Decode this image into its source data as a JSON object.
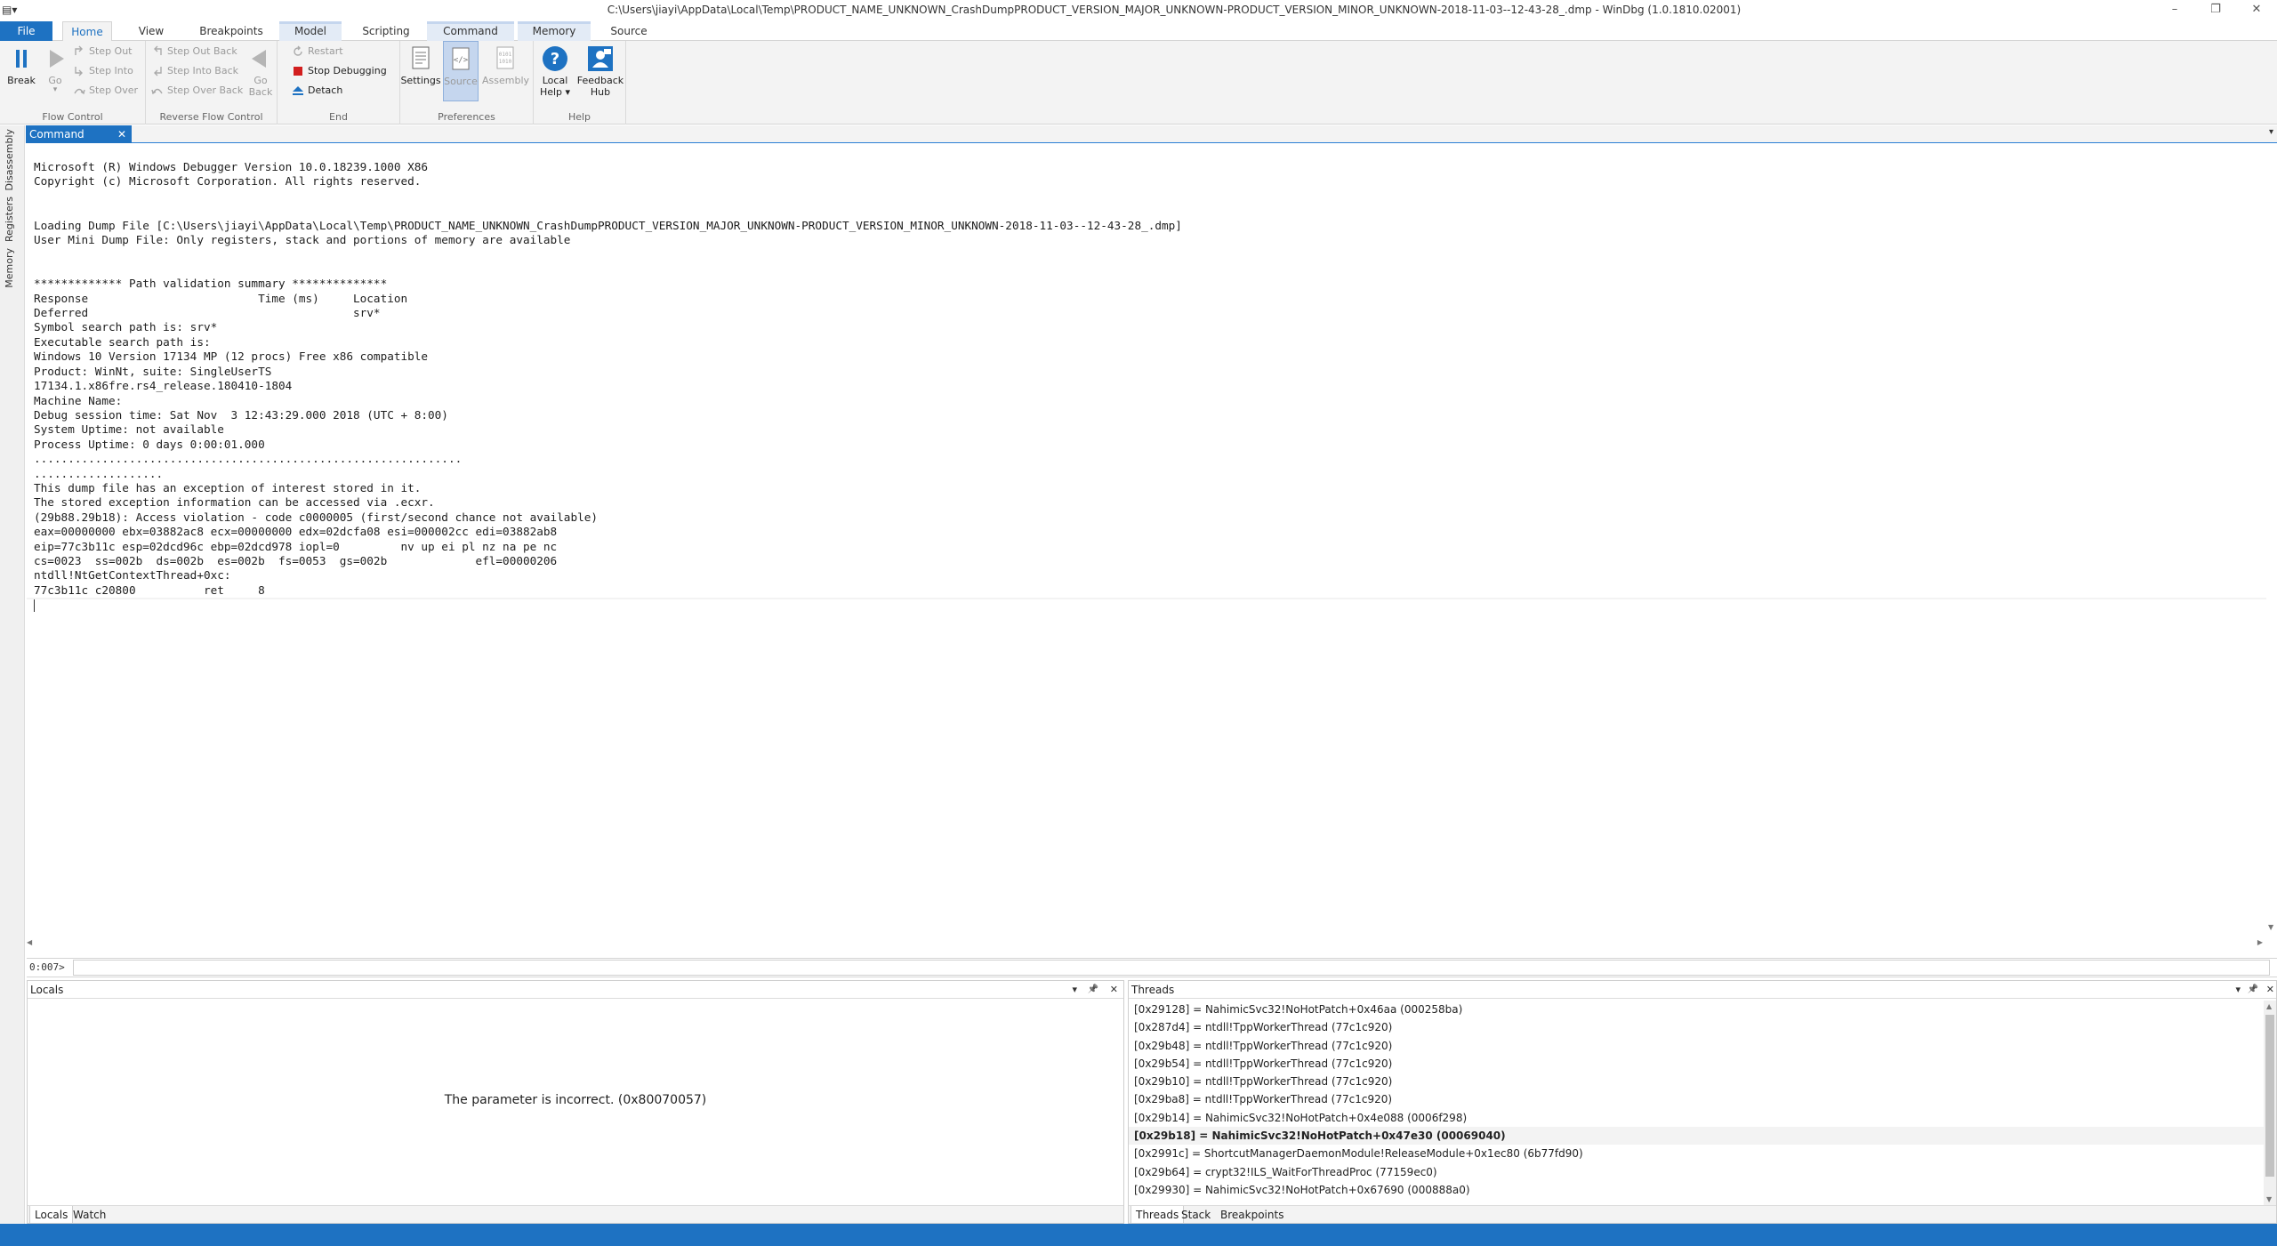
{
  "window": {
    "title": "C:\\Users\\jiayi\\AppData\\Local\\Temp\\PRODUCT_NAME_UNKNOWN_CrashDumpPRODUCT_VERSION_MAJOR_UNKNOWN-PRODUCT_VERSION_MINOR_UNKNOWN-2018-11-03--12-43-28_.dmp - WinDbg (1.0.1810.02001)",
    "system_menu_icon": "app-menu-icon",
    "minimize": "–",
    "restore": "❐",
    "close": "✕"
  },
  "ribbon_tabs": [
    "File",
    "Home",
    "View",
    "Breakpoints",
    "Model",
    "Scripting",
    "Command",
    "Memory",
    "Source"
  ],
  "ribbon": {
    "flow_control": {
      "label": "Flow Control",
      "break": "Break",
      "go": "Go",
      "go_arrow": "▾",
      "step_out": "Step Out",
      "step_into": "Step Into",
      "step_over": "Step Over"
    },
    "reverse_flow_control": {
      "label": "Reverse Flow Control",
      "step_out_back": "Step Out Back",
      "step_into_back": "Step Into Back",
      "step_over_back": "Step Over Back",
      "go_back_line1": "Go",
      "go_back_line2": "Back"
    },
    "end": {
      "label": "End",
      "restart": "Restart",
      "stop_debugging": "Stop Debugging",
      "detach": "Detach"
    },
    "preferences": {
      "label": "Preferences",
      "settings": "Settings",
      "source": "Source",
      "assembly": "Assembly"
    },
    "help": {
      "label": "Help",
      "local_help_line1": "Local",
      "local_help_line2": "Help ▾",
      "feedback_line1": "Feedback",
      "feedback_line2": "Hub"
    },
    "colors": {
      "break": "#1e72c2",
      "stop": "#d21e1e",
      "help": "#1e72c2"
    }
  },
  "side_tabs": [
    "Disassembly",
    "Registers",
    "Memory"
  ],
  "command_window": {
    "tab": "Command",
    "close": "✕",
    "menu": "▾",
    "output": "Microsoft (R) Windows Debugger Version 10.0.18239.1000 X86\nCopyright (c) Microsoft Corporation. All rights reserved.\n\n\nLoading Dump File [C:\\Users\\jiayi\\AppData\\Local\\Temp\\PRODUCT_NAME_UNKNOWN_CrashDumpPRODUCT_VERSION_MAJOR_UNKNOWN-PRODUCT_VERSION_MINOR_UNKNOWN-2018-11-03--12-43-28_.dmp]\nUser Mini Dump File: Only registers, stack and portions of memory are available\n\n\n************* Path validation summary **************\nResponse                         Time (ms)     Location\nDeferred                                       srv*\nSymbol search path is: srv*\nExecutable search path is:\nWindows 10 Version 17134 MP (12 procs) Free x86 compatible\nProduct: WinNt, suite: SingleUserTS\n17134.1.x86fre.rs4_release.180410-1804\nMachine Name:\nDebug session time: Sat Nov  3 12:43:29.000 2018 (UTC + 8:00)\nSystem Uptime: not available\nProcess Uptime: 0 days 0:00:01.000\n...............................................................\n...................\nThis dump file has an exception of interest stored in it.\nThe stored exception information can be accessed via .ecxr.\n(29b88.29b18): Access violation - code c0000005 (first/second chance not available)\neax=00000000 ebx=03882ac8 ecx=00000000 edx=02dcfa08 esi=000002cc edi=03882ab8\neip=77c3b11c esp=02dcd96c ebp=02dcd978 iopl=0         nv up ei pl nz na pe nc\ncs=0023  ss=002b  ds=002b  es=002b  fs=0053  gs=002b             efl=00000206\nntdll!NtGetContextThread+0xc:\n77c3b11c c20800          ret     8",
    "prompt": "0:007>",
    "input_value": ""
  },
  "locals_panel": {
    "title": "Locals",
    "message": "The parameter is incorrect. (0x80070057)",
    "tabs": [
      "Locals",
      "Watch"
    ],
    "menu": "▾",
    "pin": "📌",
    "close": "✕"
  },
  "threads_panel": {
    "title": "Threads",
    "menu": "▾",
    "pin": "📌",
    "close": "✕",
    "threads": [
      "[0x29128] = NahimicSvc32!NoHotPatch+0x46aa (000258ba)",
      "[0x287d4] = ntdll!TppWorkerThread (77c1c920)",
      "[0x29b48] = ntdll!TppWorkerThread (77c1c920)",
      "[0x29b54] = ntdll!TppWorkerThread (77c1c920)",
      "[0x29b10] = ntdll!TppWorkerThread (77c1c920)",
      "[0x29ba8] = ntdll!TppWorkerThread (77c1c920)",
      "[0x29b14] = NahimicSvc32!NoHotPatch+0x4e088 (0006f298)",
      "[0x29b18] = NahimicSvc32!NoHotPatch+0x47e30 (00069040)",
      "[0x2991c] = ShortcutManagerDaemonModule!ReleaseModule+0x1ec80 (6b77fd90)",
      "[0x29b64] = crypt32!ILS_WaitForThreadProc (77159ec0)",
      "[0x29930] = NahimicSvc32!NoHotPatch+0x67690 (000888a0)"
    ],
    "current_index": 7,
    "tabs": [
      "Threads",
      "Stack",
      "Breakpoints"
    ]
  }
}
